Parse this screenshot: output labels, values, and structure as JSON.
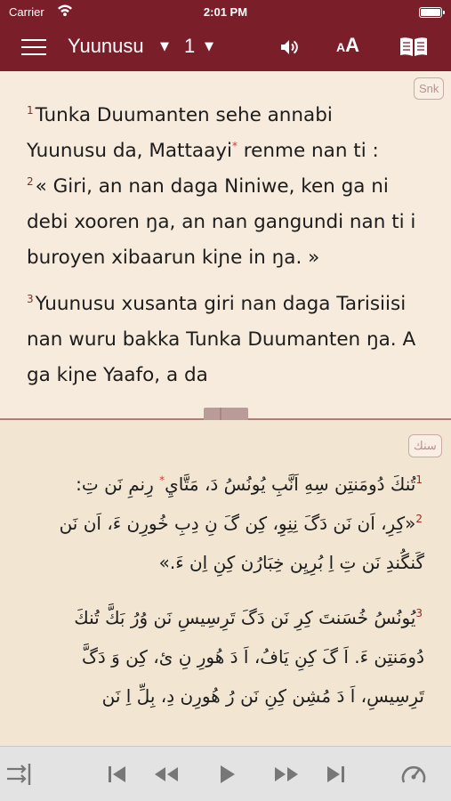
{
  "status": {
    "carrier": "Carrier",
    "time": "2:01 PM"
  },
  "nav": {
    "book": "Yuunusu",
    "chapter": "1",
    "font_button": {
      "small": "A",
      "big": "A"
    }
  },
  "top_pane": {
    "language_tag": "Snk",
    "verses": [
      {
        "num": "1",
        "text_before": "Tunka Duumanten sehe annabi Yuunusu da, Mattaayi",
        "footnote": "*",
        "text_after": " renme nan ti :"
      },
      {
        "num": "2",
        "text": "« Giri, an nan daga Niniwe, ken ga ni debi xooren ŋa, an nan gangundi nan ti i buroyen xibaarun kiɲe in ŋa. »"
      },
      {
        "num": "3",
        "text": "Yuunusu xusanta giri nan daga Tarisiisi nan wuru bakka Tunka Duumanten ŋa. A ga kiɲe Yaafo, a da"
      }
    ]
  },
  "bottom_pane": {
    "language_tag": "سنك",
    "verses": [
      {
        "num": "1",
        "text_before": "تُنكَ دُومَنتِن سِهِ اَنَّبِ يُونُسُ دَ، مَتَّايِ",
        "footnote": "*",
        "text_after": " رِنمِ نَن تِ:"
      },
      {
        "num": "2",
        "text": "«كِرِ، اَن نَن دَگَ نِنِوِ، كِن گَ نِ دِبِ خُورِن ءَ، اَن نَن گَنگُندِ نَن تِ اِ بُرِيِن خِبَارُن كِنِ اِن ءَ.»"
      },
      {
        "num": "3",
        "text": "يُونُسُ خُسَنتَ كِرِ نَن دَگَ تَرِسِيسِ نَن وُرُ بَكَّ تُنكَ دُومَنتِن ءَ. اَ گَ كِنِ يَافُ، اَ دَ هُورِ نِ ئ، كِن وَ دَگَّ تَرِسِيسِ، اَ دَ مُشِن كِنِ نَن رُ هُورِن دِ، بِلِّ اِ نَن"
      }
    ]
  },
  "colors": {
    "header": "#7a1f2a",
    "page": "#f6ebdc",
    "bottom_page": "#f2e6d2",
    "verse_number": "#8f2a2a",
    "footnote_mark": "#c83b3b",
    "toolbar": "#e3e3e3"
  },
  "icons": {
    "status": [
      "wifi-icon",
      "battery-icon"
    ],
    "nav": [
      "menu-icon",
      "caret-down-icon",
      "speaker-icon",
      "font-size-icon",
      "bible-icon"
    ],
    "toolbar": [
      "playback-settings-icon",
      "skip-previous-icon",
      "rewind-icon",
      "play-icon",
      "fast-forward-icon",
      "skip-next-icon",
      "speed-icon"
    ]
  }
}
